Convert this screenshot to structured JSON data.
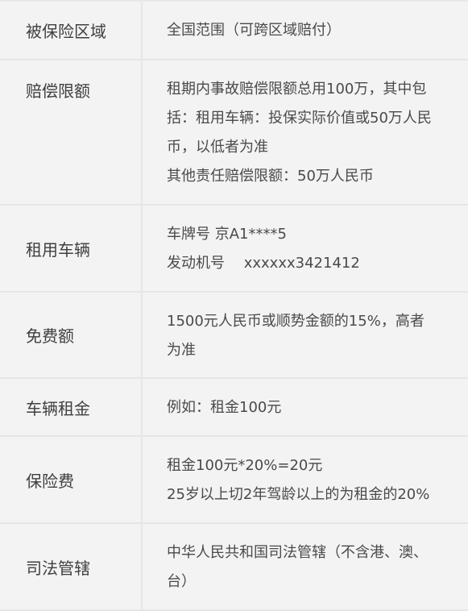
{
  "rows": [
    {
      "label": "被保险区域",
      "lines": [
        "全国范围（可跨区域赔付）"
      ]
    },
    {
      "label": "赔偿限额",
      "lines": [
        "租期内事故赔偿限额总用100万，其中包",
        "括：租用车辆：投保实际价值或50万人民",
        "币，以低者为准",
        "其他责任赔偿限额：50万人民币"
      ]
    },
    {
      "label": "租用车辆",
      "lines": [
        "车牌号 京A1****5",
        "发动机号 　xxxxxx3421412"
      ]
    },
    {
      "label": "免费额",
      "lines": [
        "1500元人民币或顺势金额的15%，高者",
        "为准"
      ]
    },
    {
      "label": "车辆租金",
      "lines": [
        "例如：租金100元"
      ]
    },
    {
      "label": "保险费",
      "lines": [
        "租金100元*20%=20元",
        "25岁以上切2年驾龄以上的为租金的20%"
      ]
    },
    {
      "label": "司法管辖",
      "lines": [
        "中华人民共和国司法管辖（不含港、澳、",
        "台）"
      ]
    }
  ]
}
